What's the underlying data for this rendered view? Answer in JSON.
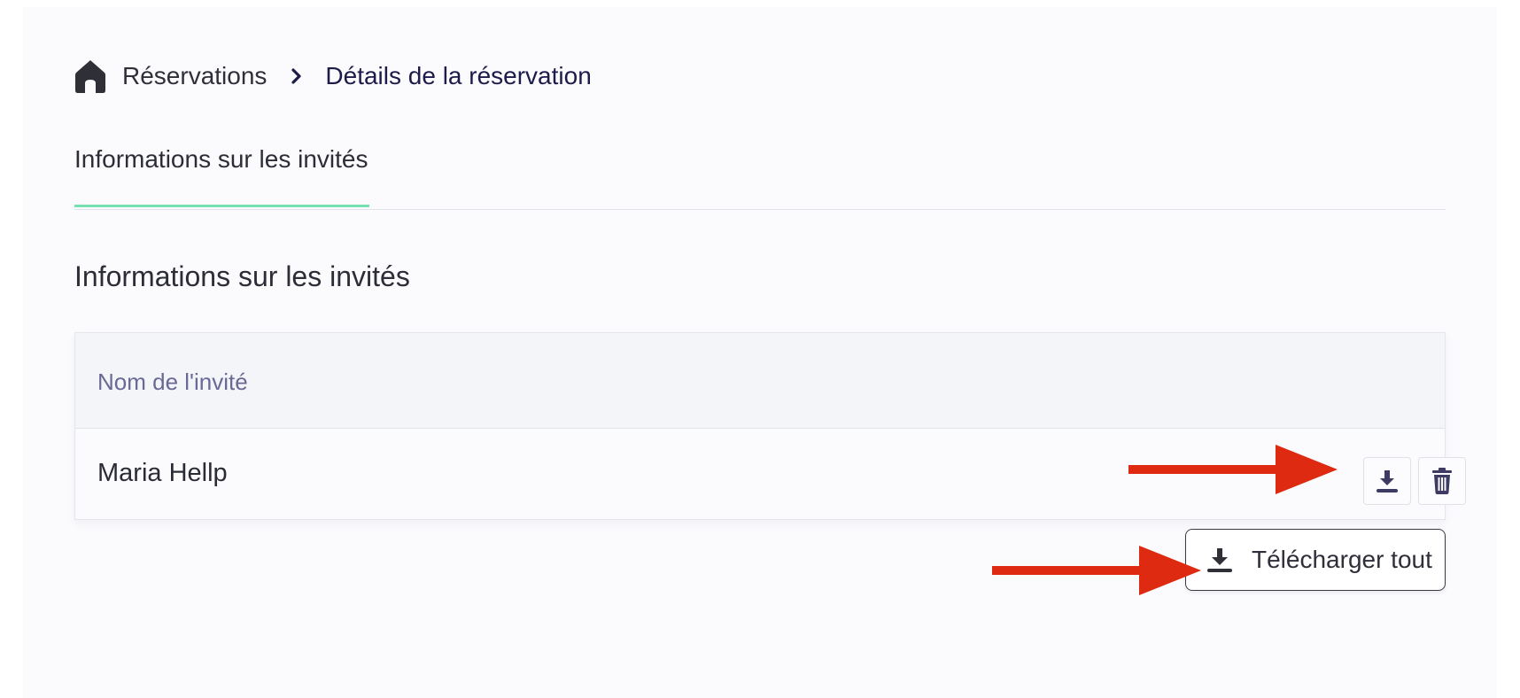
{
  "breadcrumb": {
    "home_icon": "home-icon",
    "items": [
      "Réservations",
      "Détails de la réservation"
    ],
    "separator_icon": "chevron-right-icon"
  },
  "tabs": [
    {
      "label": "Informations sur les invités",
      "active": true
    }
  ],
  "section": {
    "title": "Informations sur les invités"
  },
  "guest_table": {
    "columns": [
      "Nom de l'invité"
    ],
    "rows": [
      {
        "name": "Maria Hellp",
        "actions": [
          "download-icon",
          "trash-icon"
        ]
      }
    ]
  },
  "download_all": {
    "label": "Télécharger tout",
    "icon": "download-icon"
  },
  "annotations": {
    "arrow_color": "#dd2a10",
    "arrows": [
      "points-to-row-download-button",
      "points-to-download-all-button"
    ]
  },
  "colors": {
    "tab_underline": "#76e0b0",
    "header_text": "#6a6995",
    "icon_color": "#3d3b63"
  }
}
